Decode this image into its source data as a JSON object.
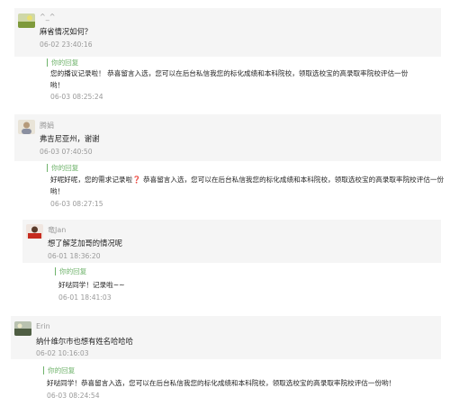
{
  "reply_label": "你的回复",
  "threads": [
    {
      "user": "^_^",
      "avatar_icon": "landscape-avatar",
      "comment": "麻省情况如何？",
      "time": "06-02 23:40:16",
      "reply": "您的播议记录啦！ 恭喜留言入选，您可以在后台私信我您的标化成绩和本科院校，领取选校宝的高录取率院校评估一份哟！",
      "reply_time": "06-03 08:25:24"
    },
    {
      "user": "腾娟",
      "avatar_icon": "person-avatar",
      "comment": "弗吉尼亚州，谢谢",
      "time": "06-03 07:40:50",
      "reply_a": "好呢好呢，您的需求记录啦",
      "reply_mark": "❓",
      "reply_b": " 恭喜留言入选，您可以在后台私信我您的标化成绩和本科院校，领取选校宝的高录取率院校评估一份哟！",
      "reply_time": "06-03 08:27:15"
    },
    {
      "user": "竜Jan",
      "avatar_icon": "red-avatar",
      "comment": "想了解芝加哥的情况呢",
      "time": "06-01 18:36:20",
      "reply": "好哒同学！记录啦~~",
      "reply_time": "06-01 18:41:03"
    },
    {
      "user": "Erin",
      "avatar_icon": "landscape-avatar",
      "comment": "纳什维尔市也想有姓名哈哈哈",
      "time": "06-02 10:16:03",
      "reply": "好哒同学！恭喜留言入选，您可以在后台私信我您的标化成绩和本科院校，领取选校宝的高录取率院校评估一份哟！",
      "reply_time": "06-03 08:24:54"
    }
  ]
}
